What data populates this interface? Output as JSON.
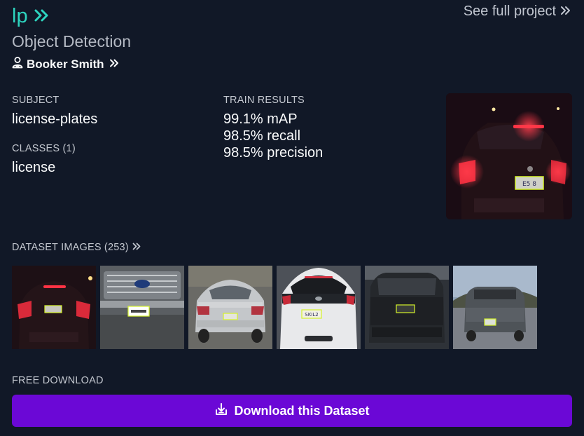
{
  "header": {
    "title": "lp",
    "see_full_project": "See full project",
    "subtitle": "Object Detection",
    "author": "Booker Smith"
  },
  "details": {
    "subject_label": "SUBJECT",
    "subject_value": "license-plates",
    "classes_label": "CLASSES (1)",
    "classes_value": "license",
    "train_results_label": "TRAIN RESULTS",
    "metrics": [
      "99.1% mAP",
      "98.5% recall",
      "98.5% precision"
    ]
  },
  "preview_plate_text": "E5 8",
  "dataset": {
    "label": "DATASET IMAGES (253)",
    "thumb_plate_texts": [
      "",
      "",
      "",
      "SKIL2",
      "",
      ""
    ]
  },
  "download": {
    "label": "FREE DOWNLOAD",
    "button_label": "Download this Dataset"
  },
  "colors": {
    "background": "#111827",
    "accent_teal": "#2dd4bf",
    "button_purple": "#6b08d6",
    "bbox_yellow": "#d4f22a"
  },
  "icons": [
    "chevron-double-right-icon",
    "user-badge-icon",
    "download-icon"
  ]
}
